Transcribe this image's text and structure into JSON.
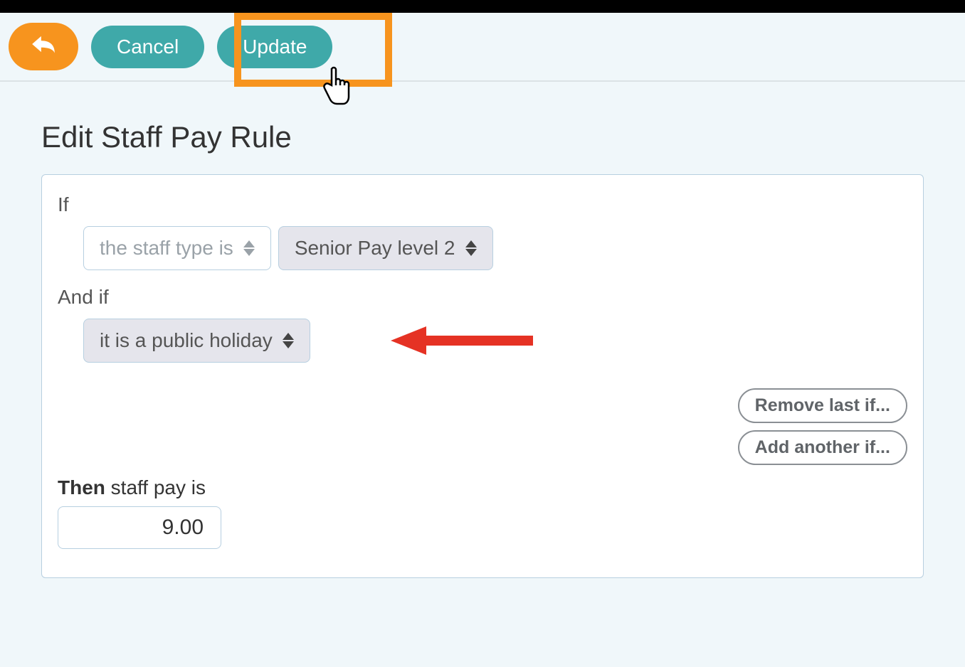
{
  "toolbar": {
    "cancel_label": "Cancel",
    "update_label": "Update"
  },
  "page": {
    "title": "Edit Staff Pay Rule"
  },
  "rule": {
    "if_label": "If",
    "andif_label": "And if",
    "condition1_field": "the staff type is",
    "condition1_value": "Senior Pay level 2",
    "condition2_value": "it is a public holiday",
    "remove_label": "Remove last if...",
    "add_label": "Add another if...",
    "then_bold": "Then",
    "then_rest": " staff pay is",
    "pay_value": "9.00"
  }
}
